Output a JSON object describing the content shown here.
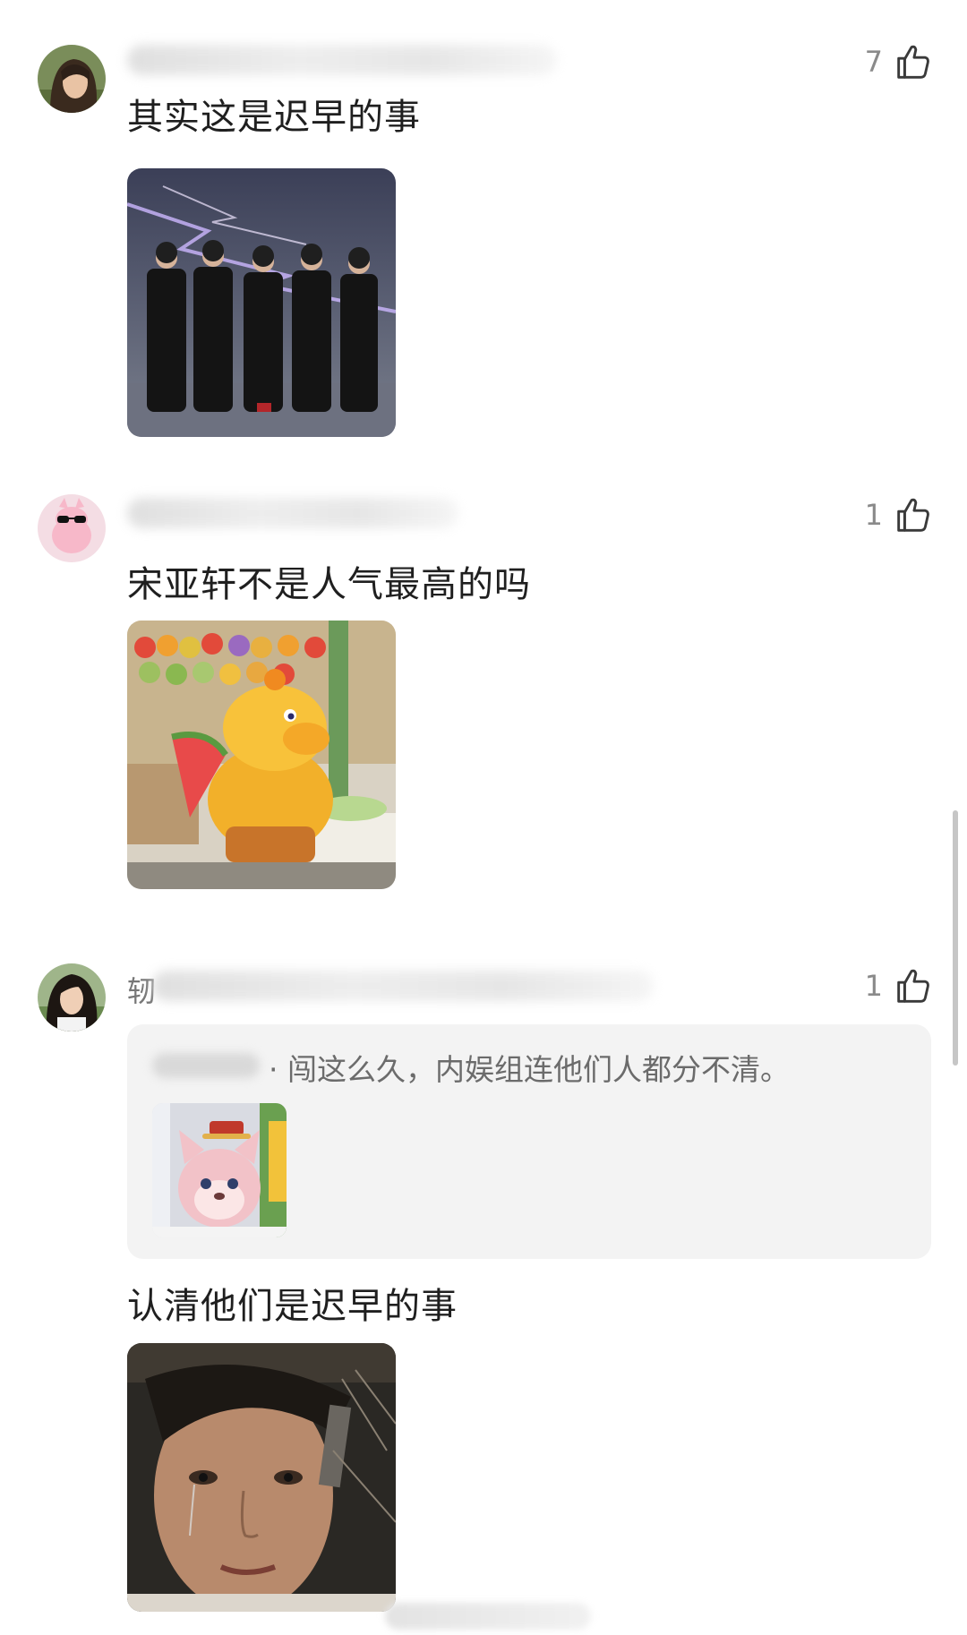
{
  "comments": [
    {
      "likes": "7",
      "text": "其实这是迟早的事",
      "avatar_icon": "woman-portrait-avatar",
      "image_icon": "group-walking-in-suits-image"
    },
    {
      "likes": "1",
      "text": "宋亚轩不是人气最高的吗",
      "avatar_icon": "pink-cartoon-sunglasses-avatar",
      "image_icon": "yellow-cartoon-duck-watermelon-image"
    },
    {
      "name_initial": "轫",
      "likes": "1",
      "quote": {
        "text": "· 闯这么久，内娱组连他们人都分不清。",
        "image_icon": "pink-fox-plush-image"
      },
      "text": "认清他们是迟早的事",
      "avatar_icon": "woman-dark-hair-avatar",
      "image_icon": "crying-girl-closeup-image"
    }
  ],
  "icons": {
    "like": "thumbs-up-icon"
  },
  "colors": {
    "text": "#1f1f1f",
    "secondary": "#8a8a8a",
    "quote_bg": "#f3f3f3"
  }
}
